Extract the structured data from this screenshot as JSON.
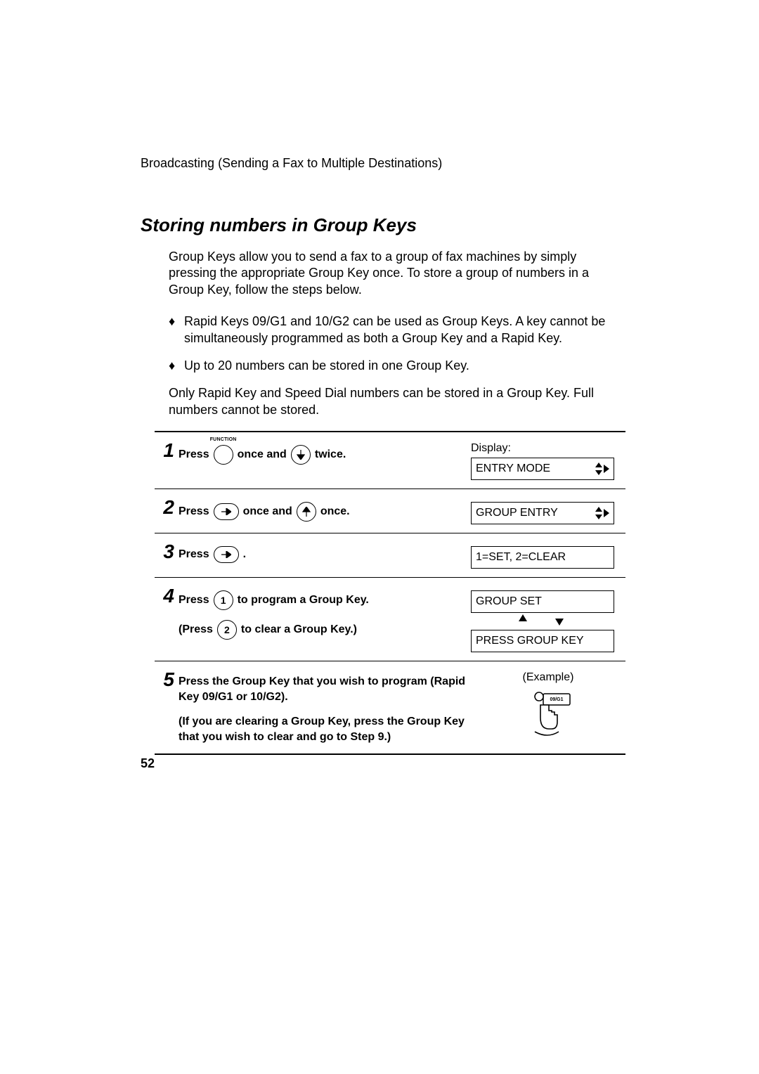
{
  "breadcrumb": "Broadcasting (Sending a Fax to Multiple Destinations)",
  "section_title": "Storing numbers in Group Keys",
  "intro": "Group Keys allow you to send a fax to a group of fax machines by simply pressing the appropriate Group Key once. To store a group of numbers in a Group Key, follow the steps below.",
  "bullets": [
    "Rapid Keys 09/G1 and 10/G2 can be used as Group Keys. A key cannot be simultaneously programmed as both a Group Key and a Rapid Key.",
    "Up to 20 numbers can be stored in one Group Key."
  ],
  "note": "Only Rapid Key and Speed Dial numbers can be stored in a Group Key. Full numbers cannot be stored.",
  "display_label": "Display:",
  "steps": {
    "s1": {
      "num": "1",
      "press": "Press",
      "once_and": "once and",
      "twice": "twice.",
      "function_label": "FUNCTION",
      "lcd": "ENTRY MODE"
    },
    "s2": {
      "num": "2",
      "press": "Press",
      "once_and": "once and",
      "once": "once.",
      "lcd": "GROUP ENTRY"
    },
    "s3": {
      "num": "3",
      "press": "Press",
      "dot": ".",
      "lcd": "1=SET, 2=CLEAR"
    },
    "s4": {
      "num": "4",
      "press": "Press",
      "key1": "1",
      "prog": "to program a Group Key.",
      "press2": "(Press",
      "key2": "2",
      "clear": "to clear a Group Key.)",
      "lcd1": "GROUP SET",
      "lcd2": "PRESS GROUP KEY"
    },
    "s5": {
      "num": "5",
      "line1": "Press the Group Key that you wish to program (Rapid Key 09/G1 or 10/G2).",
      "line2": "(If you are clearing a Group Key, press the Group Key that you wish to clear and go to Step 9.)",
      "example": "(Example)",
      "key_label": "09/G1"
    }
  },
  "page_number": "52"
}
